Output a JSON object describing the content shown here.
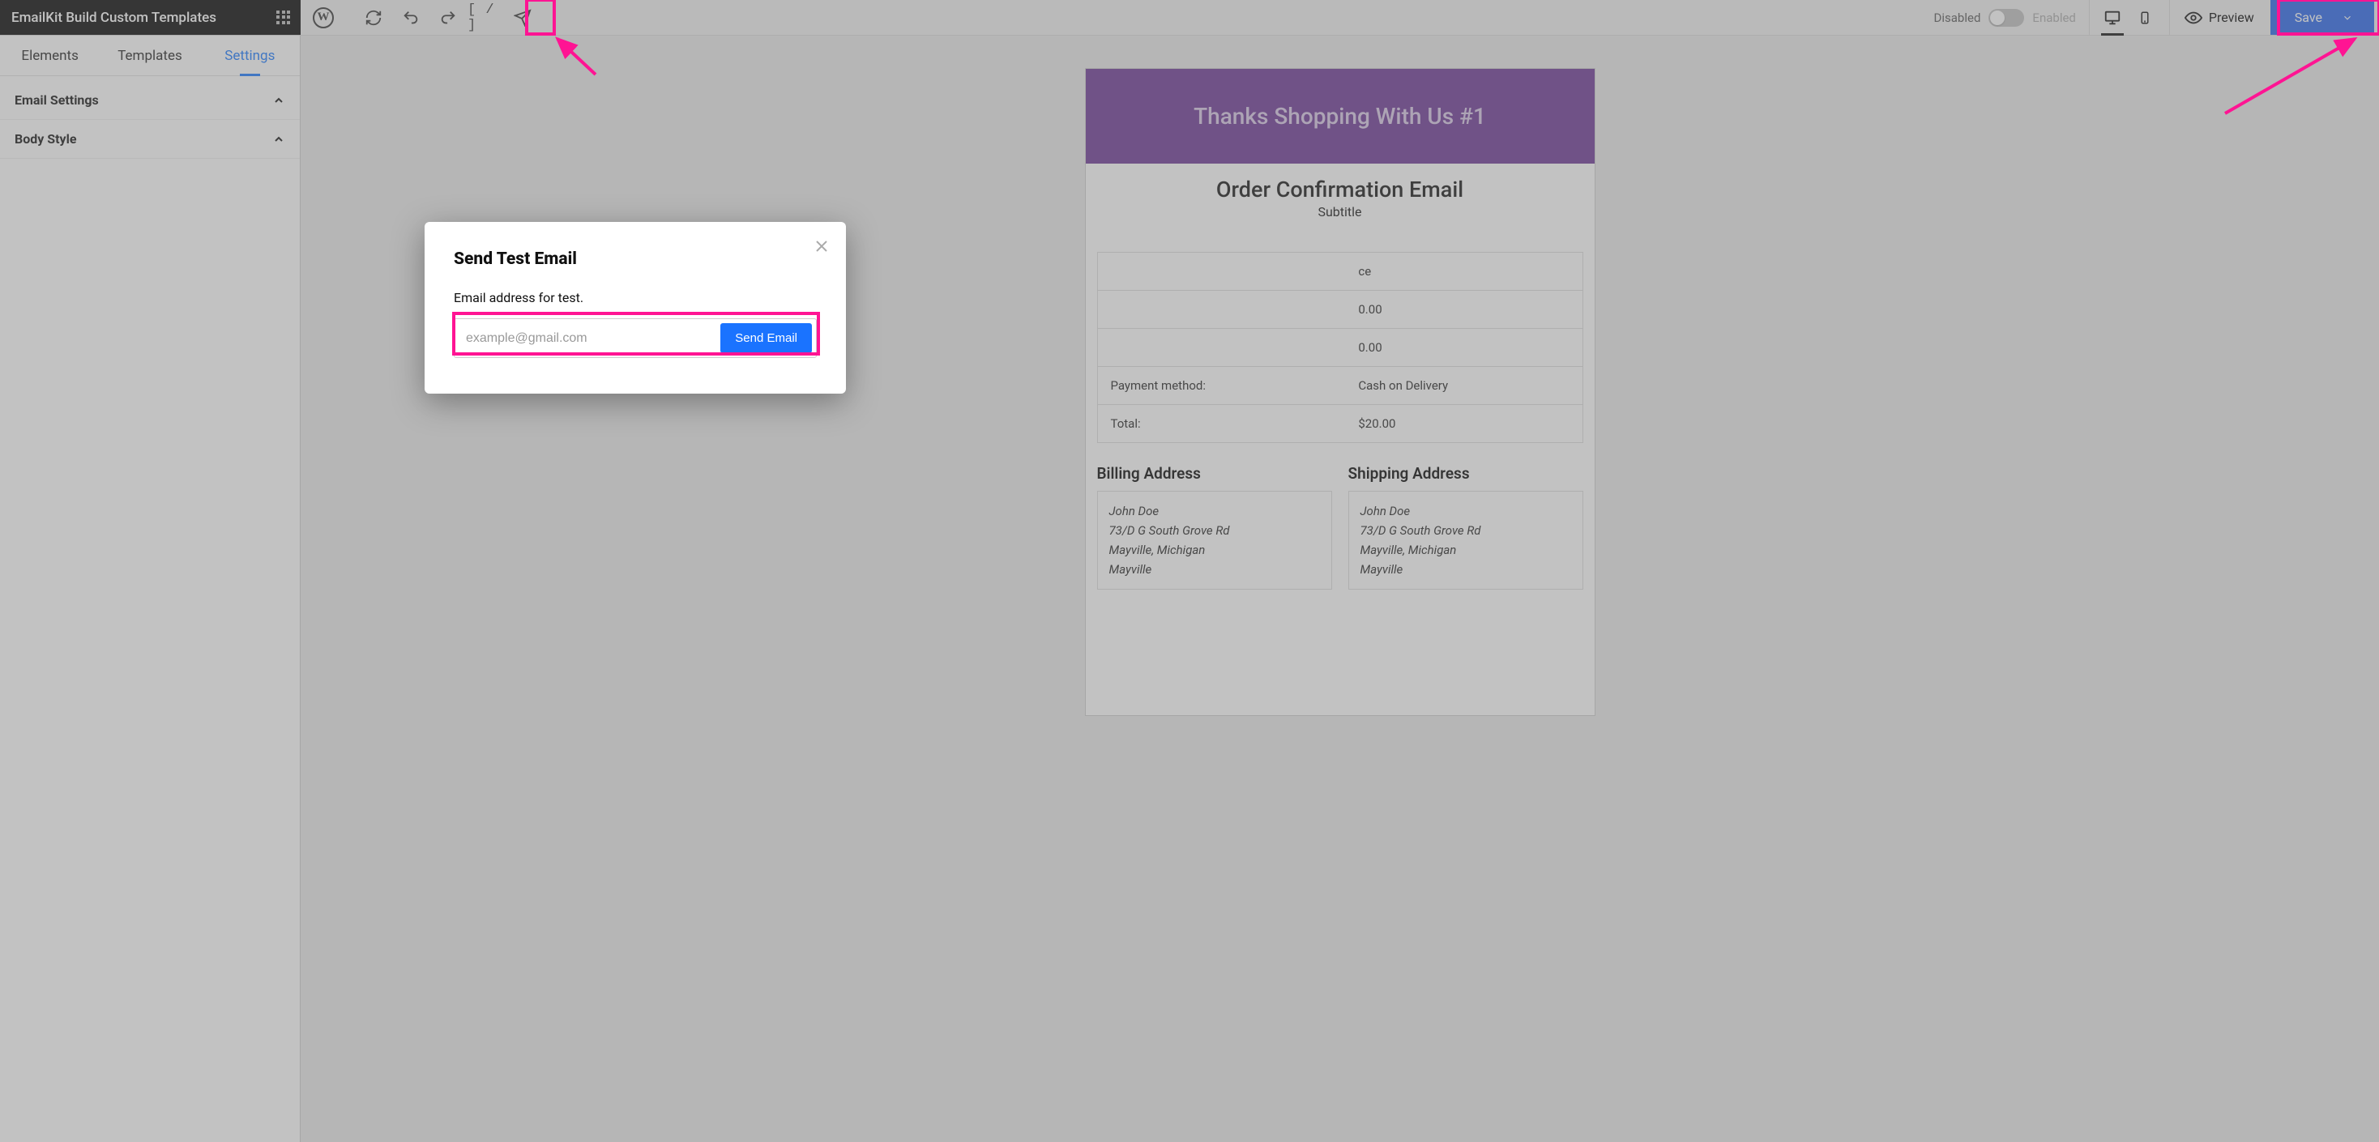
{
  "brand": {
    "title": "EmailKit Build Custom Templates"
  },
  "toolbar": {
    "disabled_label": "Disabled",
    "enabled_label": "Enabled",
    "preview_label": "Preview",
    "save_label": "Save",
    "shortcode_label": "[ / ]"
  },
  "tabs": {
    "elements": "Elements",
    "templates": "Templates",
    "settings": "Settings"
  },
  "accordion": {
    "email_settings": "Email Settings",
    "body_style": "Body Style"
  },
  "email": {
    "banner": "Thanks Shopping With Us #1",
    "title": "Order Confirmation Email",
    "subtitle": "Subtitle",
    "rows": [
      {
        "label": "",
        "value": "ce"
      },
      {
        "label": "",
        "value": "0.00"
      },
      {
        "label": "",
        "value": "0.00"
      },
      {
        "label": "Payment method:",
        "value": "Cash on Delivery"
      },
      {
        "label": "Total:",
        "value": "$20.00"
      }
    ],
    "billing_heading": "Billing Address",
    "shipping_heading": "Shipping Address",
    "address": {
      "name": "John Doe",
      "street": "73/D G South Grove Rd",
      "citystate": "Mayville, Michigan",
      "city": "Mayville"
    }
  },
  "modal": {
    "title": "Send Test Email",
    "label": "Email address for test.",
    "placeholder": "example@gmail.com",
    "button": "Send Email"
  }
}
